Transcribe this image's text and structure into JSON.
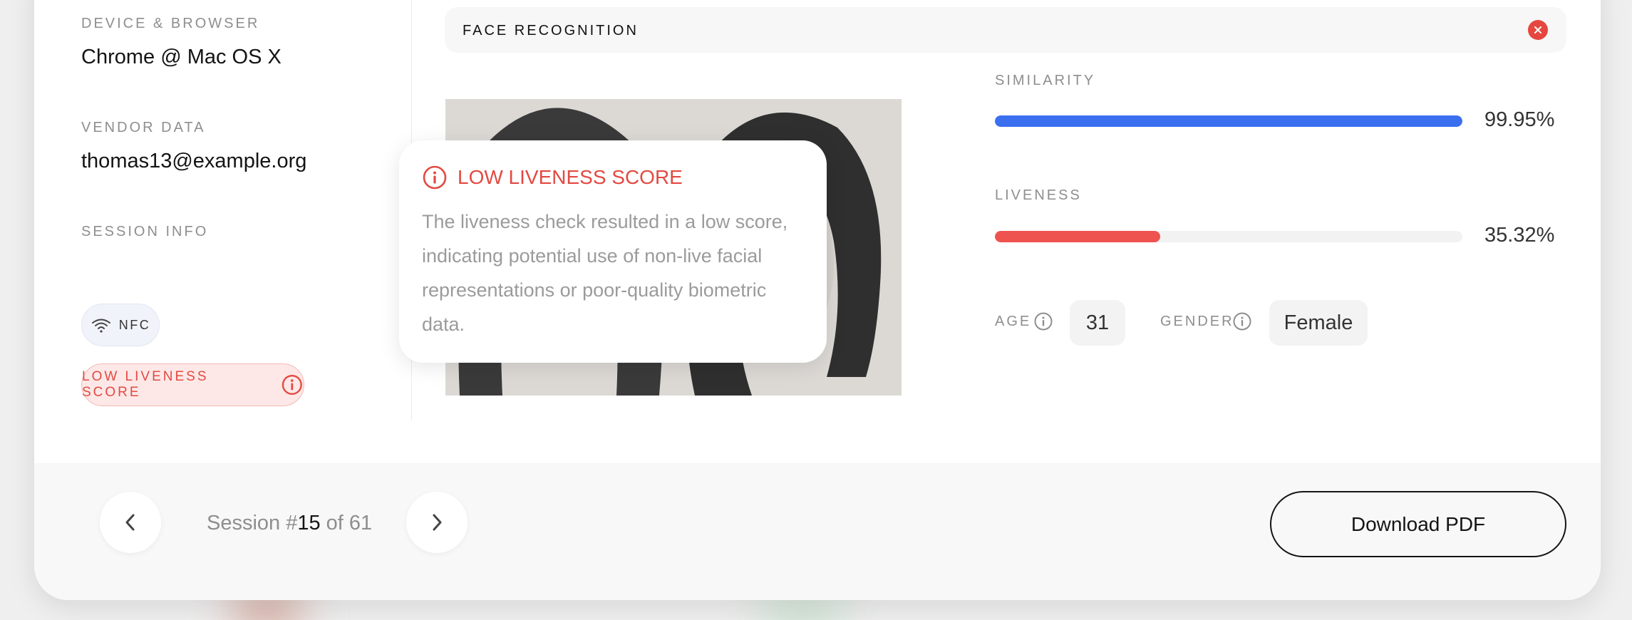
{
  "left": {
    "device": {
      "label": "DEVICE & BROWSER",
      "value": "Chrome @ Mac OS X"
    },
    "vendor": {
      "label": "VENDOR DATA",
      "value": "thomas13@example.org"
    },
    "session": {
      "label": "SESSION INFO",
      "chips": {
        "nfc": "NFC",
        "liveness": "LOW LIVENESS SCORE"
      }
    }
  },
  "face_recognition": {
    "title": "FACE RECOGNITION",
    "similarity": {
      "label": "SIMILARITY",
      "value": "99.95%",
      "fraction": 0.9995
    },
    "liveness": {
      "label": "LIVENESS",
      "value": "35.32%",
      "fraction": 0.3532
    },
    "age": {
      "label": "AGE",
      "value": "31"
    },
    "gender": {
      "label": "GENDER",
      "value": "Female"
    }
  },
  "tooltip": {
    "title": "LOW LIVENESS SCORE",
    "body": "The liveness check resulted in a low score, indicating potential use of non-live facial representations or poor-quality biometric data."
  },
  "footer": {
    "session_prefix": "Session #",
    "session_number": "15",
    "session_suffix": " of 61",
    "download_label": "Download PDF"
  },
  "colors": {
    "similarity_bar": "#3a6ff0",
    "liveness_bar": "#ef5350",
    "alert": "#e24a42"
  },
  "icons": [
    "wifi-icon",
    "info-icon",
    "close-icon",
    "chevron-left-icon",
    "chevron-right-icon"
  ]
}
